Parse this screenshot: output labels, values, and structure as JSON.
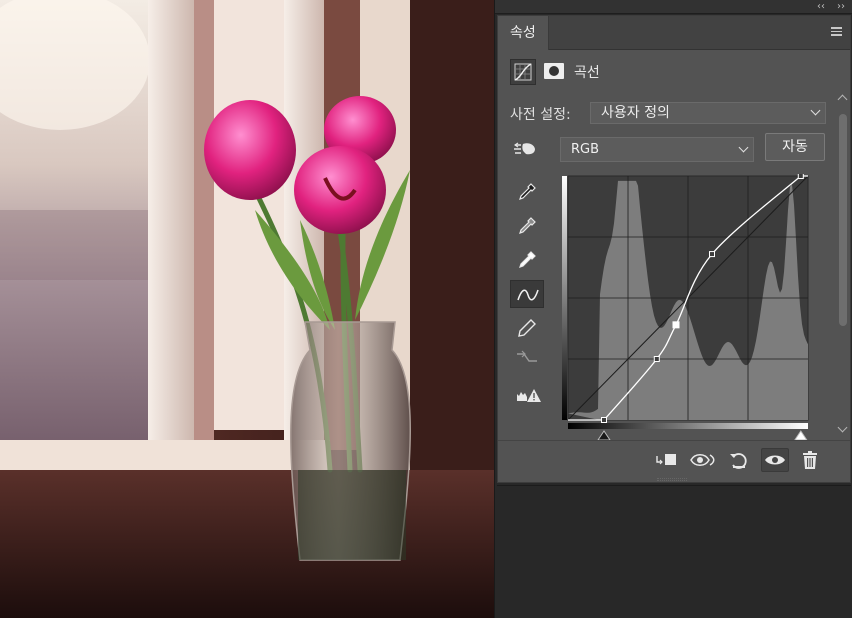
{
  "window": {
    "collapse_icon": "double-chevron-left-icon",
    "close_icon": "double-chevron-right-icon"
  },
  "canvas": {
    "subject": "pink-tulips-in-glass-vase-by-window"
  },
  "properties_panel": {
    "tab_label": "속성",
    "menu_icon": "hamburger-menu-icon",
    "adjustment_title": "곡선",
    "adjustment_icon": "curves-adjustment-icon",
    "mask_icon": "layer-mask-icon",
    "preset_label": "사전 설정:",
    "preset_value": "사용자 정의",
    "channel_value": "RGB",
    "auto_label": "자동",
    "tools": [
      "target-adjust-hand-icon",
      "black-point-eyedropper-icon",
      "gray-point-eyedropper-icon",
      "white-point-eyedropper-icon",
      "curve-points-icon",
      "pencil-icon",
      "smooth-curve-icon",
      "clipping-warning-icon"
    ],
    "curve_points": [
      {
        "input": 0.15,
        "output": 0.0
      },
      {
        "input": 0.37,
        "output": 0.25
      },
      {
        "input": 0.45,
        "output": 0.39
      },
      {
        "input": 0.6,
        "output": 0.68
      },
      {
        "input": 0.97,
        "output": 1.0
      }
    ],
    "selected_point_index": 2,
    "bottom_actions": [
      "clip-to-layer-icon",
      "view-previous-state-icon",
      "reset-adjustment-icon",
      "toggle-visibility-icon",
      "delete-adjustment-icon"
    ],
    "colors": {
      "panel_bg": "#535353",
      "graph_bg": "#3c3c3c",
      "histogram": "#7d7d7d",
      "curve": "#ffffff"
    }
  }
}
